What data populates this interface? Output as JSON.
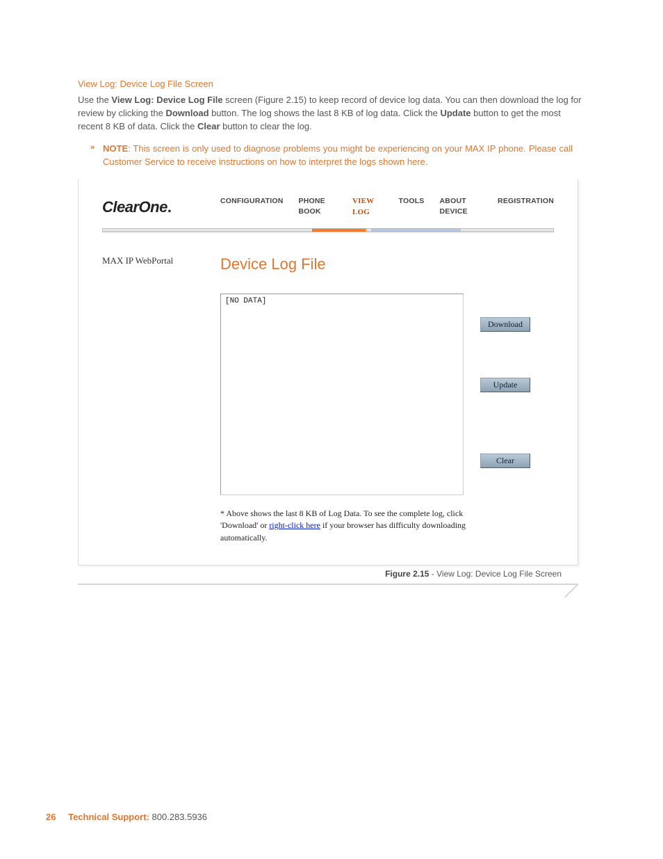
{
  "heading": "View Log: Device Log File Screen",
  "intro": {
    "t1": "Use the ",
    "b1": "View Log: Device Log File",
    "t2": " screen (Figure 2.15) to keep record of device log data. You can then download the log for review by clicking the ",
    "b2": "Download",
    "t3": " button. The log shows the last 8 KB of log data. Click the ",
    "b3": "Update",
    "t4": " button to get the most recent 8 KB of data. Click the ",
    "b4": "Clear",
    "t5": " button to clear the log."
  },
  "note_marker": "»",
  "note": {
    "b": "NOTE",
    "rest": ": This screen is only used to diagnose problems you might be experiencing on your MAX IP phone. Please call Customer Service to receive instructions on how to interpret the logs shown here."
  },
  "figure": {
    "logo_main": "ClearOne",
    "logo_dot": ".",
    "menu": [
      "CONFIGURATION",
      "PHONE BOOK",
      "VIEW LOG",
      "TOOLS",
      "ABOUT DEVICE",
      "REGISTRATION"
    ],
    "sidebar_label": "MAX IP WebPortal",
    "title": "Device Log File",
    "log_content": "[NO DATA]",
    "buttons": {
      "download": "Download",
      "update": "Update",
      "clear": "Clear"
    },
    "footnote_pre": "* Above shows the last 8 KB of Log Data. To see the complete log, click 'Download' or ",
    "footnote_link": "right-click here",
    "footnote_post": " if your browser has difficulty downloading automatically."
  },
  "caption": {
    "bold": "Figure 2.15",
    "rest": " - View Log: Device Log File Screen"
  },
  "footer": {
    "page": "26",
    "label": "Technical Support: ",
    "number": "800.283.5936"
  }
}
